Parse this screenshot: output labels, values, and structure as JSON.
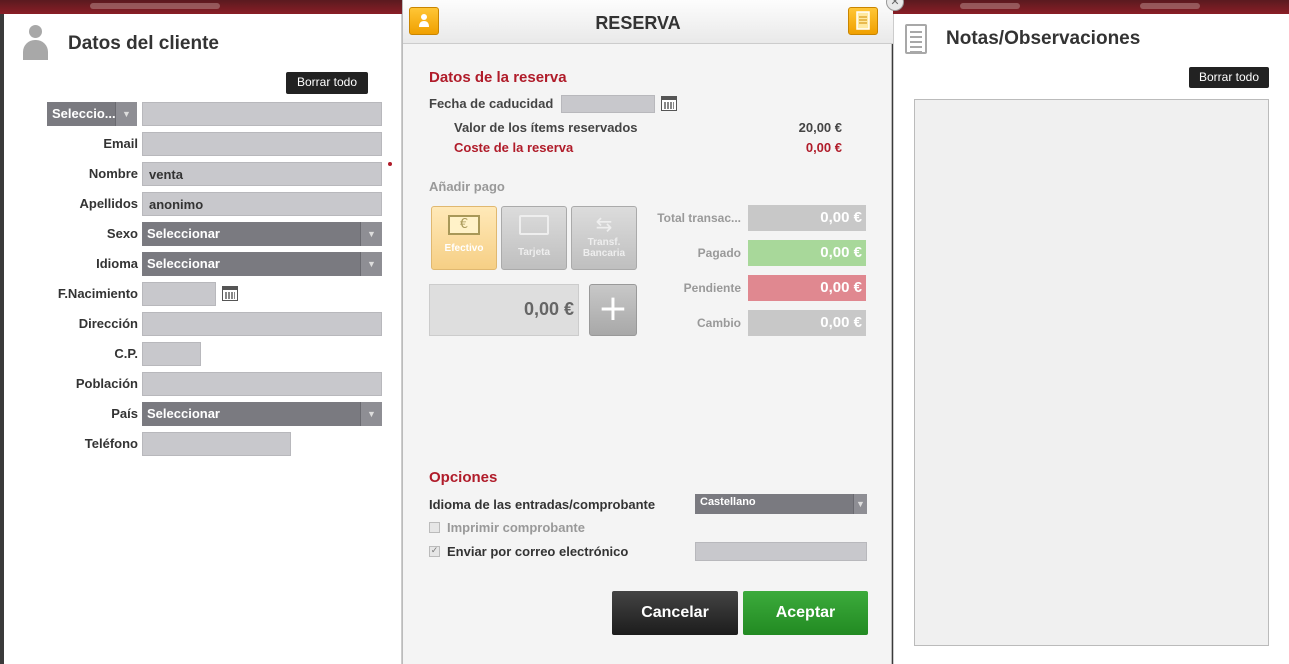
{
  "left": {
    "title": "Datos del cliente",
    "clear_button": "Borrar todo",
    "fields": {
      "type_select": "Seleccio...",
      "email_label": "Email",
      "nombre_label": "Nombre",
      "nombre_value": "venta",
      "apellidos_label": "Apellidos",
      "apellidos_value": "anonimo",
      "sexo_label": "Sexo",
      "sexo_value": "Seleccionar",
      "idioma_label": "Idioma",
      "idioma_value": "Seleccionar",
      "nacimiento_label": "F.Nacimiento",
      "direccion_label": "Dirección",
      "cp_label": "C.P.",
      "poblacion_label": "Población",
      "pais_label": "País",
      "pais_value": "Seleccionar",
      "telefono_label": "Teléfono"
    }
  },
  "center": {
    "title": "RESERVA",
    "reservation_section": "Datos de la reserva",
    "expiry_label": "Fecha de caducidad",
    "items_value_label": "Valor de los ítems reservados",
    "items_value": "20,00 €",
    "cost_label": "Coste de la reserva",
    "cost_value": "0,00 €",
    "add_payment_label": "Añadir pago",
    "payment_methods": [
      {
        "label": "Efectivo",
        "icon": "€"
      },
      {
        "label": "Tarjeta",
        "icon": "card"
      },
      {
        "label": "Transf. Bancaria",
        "icon": "arrows"
      }
    ],
    "amount": "0,00 €",
    "totals": {
      "total_label": "Total transac...",
      "total_value": "0,00 €",
      "paid_label": "Pagado",
      "paid_value": "0,00 €",
      "pending_label": "Pendiente",
      "pending_value": "0,00 €",
      "change_label": "Cambio",
      "change_value": "0,00 €"
    },
    "options_section": "Opciones",
    "language_label": "Idioma de las entradas/comprobante",
    "language_value": "Castellano",
    "print_label": "Imprimir comprobante",
    "email_label": "Enviar por correo electrónico",
    "cancel_button": "Cancelar",
    "accept_button": "Aceptar"
  },
  "right": {
    "title": "Notas/Observaciones",
    "clear_button": "Borrar todo"
  },
  "colors": {
    "accent_red": "#b01c2a",
    "accept_green": "#2f9a2f",
    "paid_green": "#a8d89a",
    "pending_red": "#e08890",
    "orange": "#f0a000"
  }
}
